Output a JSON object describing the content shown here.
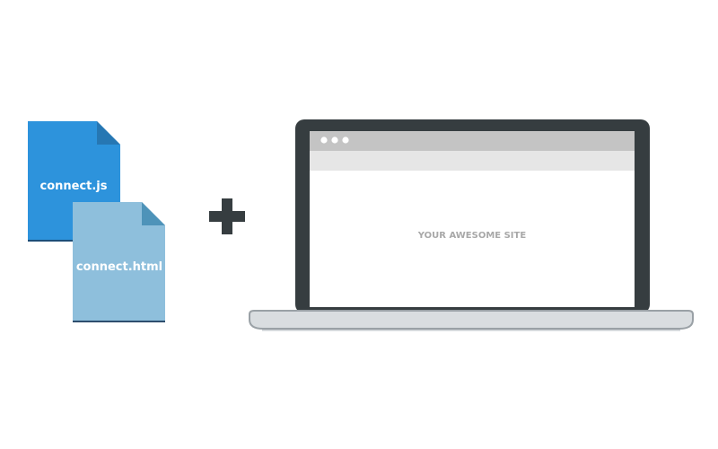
{
  "files": [
    {
      "label": "connect.js",
      "color": "#2d93dc",
      "fold_color": "#2677b3",
      "base_color": "#1c4d78"
    },
    {
      "label": "connect.html",
      "color": "#8ebfdc",
      "fold_color": "#4e93b9",
      "base_color": "#2e4e6e"
    }
  ],
  "plus_icon": {
    "icon": "plus-icon",
    "color": "#363d40"
  },
  "laptop": {
    "icon": "laptop-icon",
    "frame_color": "#363d40",
    "base_color": "#d9dde0",
    "screen_color": "#ffffff",
    "browser": {
      "titlebar_color": "#c4c4c4",
      "addressbar_color": "#e6e6e6",
      "dot_color": "#ffffff",
      "site_text": "YOUR AWESOME SITE"
    }
  }
}
